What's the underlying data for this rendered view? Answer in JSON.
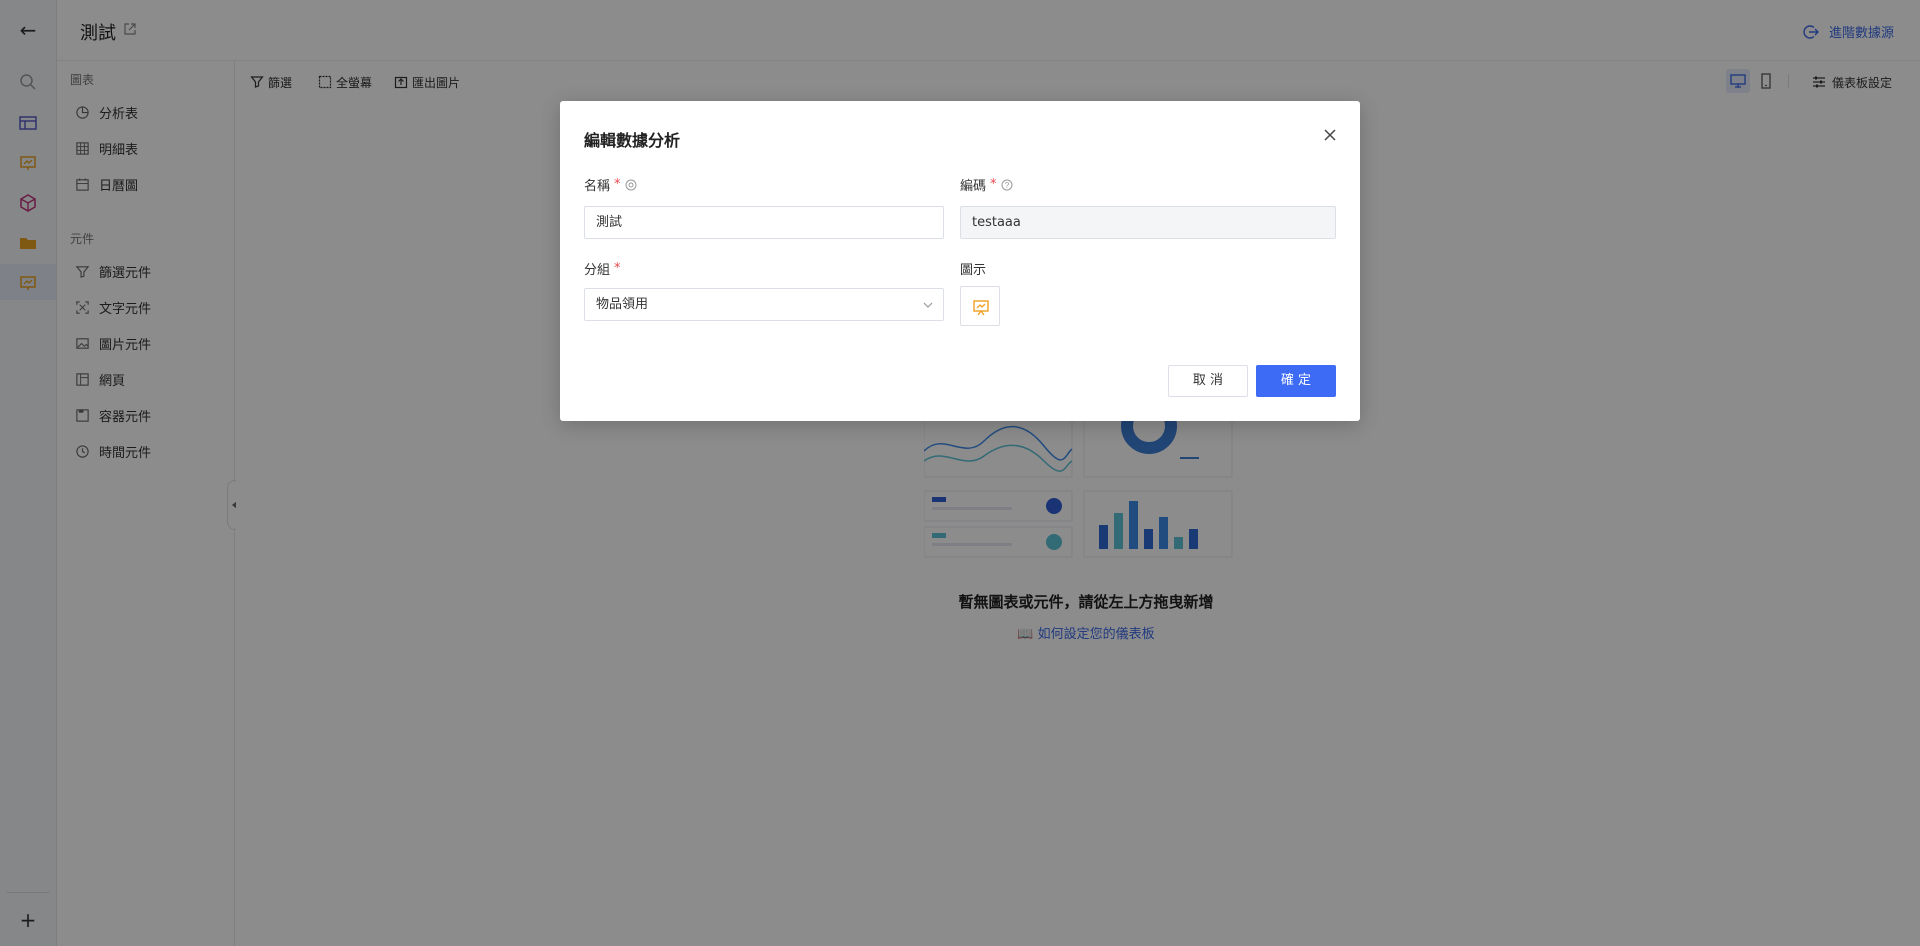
{
  "header": {
    "title": "測試",
    "goto_source": "進階數據源"
  },
  "panel": {
    "section_charts": "圖表",
    "charts": [
      {
        "label": "分析表"
      },
      {
        "label": "明細表"
      },
      {
        "label": "日曆圖"
      }
    ],
    "section_components": "元件",
    "components": [
      {
        "label": "篩選元件"
      },
      {
        "label": "文字元件"
      },
      {
        "label": "圖片元件"
      },
      {
        "label": "網頁"
      },
      {
        "label": "容器元件"
      },
      {
        "label": "時間元件"
      }
    ]
  },
  "toolbar": {
    "filter": "篩選",
    "fullscreen": "全螢幕",
    "export": "匯出圖片",
    "dashboard_settings": "儀表板設定"
  },
  "empty": {
    "message": "暫無圖表或元件，請從左上方拖曳新增",
    "help_link": "如何設定您的儀表板"
  },
  "dialog": {
    "title": "編輯數據分析",
    "name_label": "名稱",
    "name_value": "測試",
    "code_label": "編碼",
    "code_value": "testaaa",
    "group_label": "分組",
    "group_value": "物品領用",
    "icon_label": "圖示",
    "cancel": "取 消",
    "confirm": "確 定"
  },
  "colors": {
    "primary": "#3d6bf5",
    "required": "#e5484d",
    "icon_accent": "#f0a020"
  }
}
